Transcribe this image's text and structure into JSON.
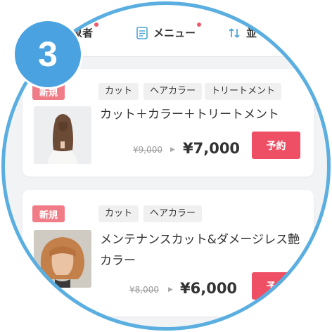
{
  "step_number": "3",
  "tabs": [
    {
      "label": "象者",
      "icon": "person-icon",
      "has_dot": true
    },
    {
      "label": "メニュー",
      "icon": "menu-list-icon",
      "has_dot": true
    },
    {
      "label": "並",
      "icon": "sort-icon",
      "has_dot": false
    }
  ],
  "menus": [
    {
      "badge": "新規",
      "tags": [
        "カット",
        "ヘアカラー",
        "トリートメント"
      ],
      "name_lines": [
        "カット＋カラー＋トリートメント"
      ],
      "old_price": "¥9,000",
      "price": "¥7,000",
      "book_label": "予約"
    },
    {
      "badge": "新規",
      "tags": [
        "カット",
        "ヘアカラー"
      ],
      "name_lines": [
        "メンテナンスカット&ダメージレス艶",
        "カラー"
      ],
      "old_price": "¥8,000",
      "price": "¥6,000",
      "book_label": "予約"
    }
  ],
  "colors": {
    "accent": "#4aa3e0",
    "book": "#ef4f65",
    "badge": "#f07c87",
    "dot": "#f0566a"
  }
}
